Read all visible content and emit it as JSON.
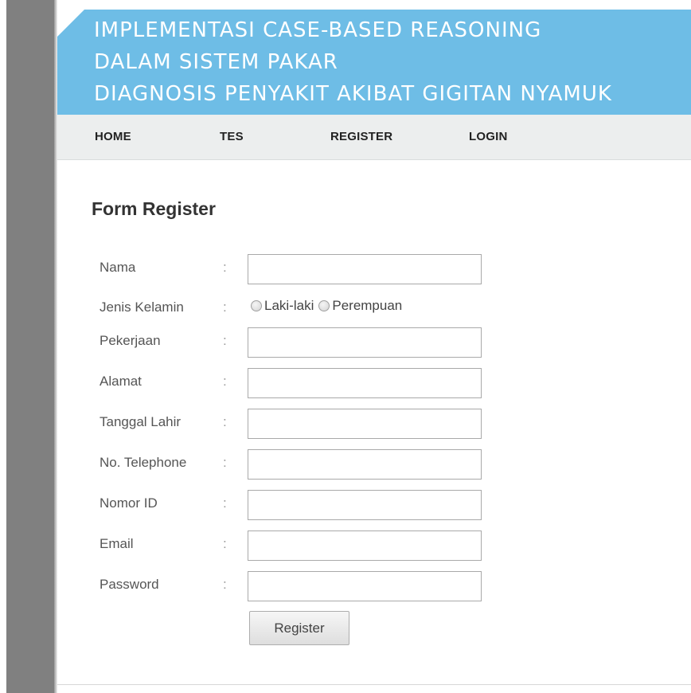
{
  "header": {
    "title_lines": [
      "IMPLEMENTASI CASE-BASED REASONING",
      "DALAM SISTEM PAKAR",
      "DIAGNOSIS PENYAKIT AKIBAT GIGITAN NYAMUK"
    ],
    "background_color": "#6ebde6"
  },
  "nav": {
    "items": [
      {
        "label": "HOME"
      },
      {
        "label": "TES"
      },
      {
        "label": "REGISTER"
      },
      {
        "label": "LOGIN"
      }
    ]
  },
  "form": {
    "title": "Form Register",
    "colon": ":",
    "fields": {
      "nama": {
        "label": "Nama",
        "value": ""
      },
      "jenis_kelamin": {
        "label": "Jenis Kelamin",
        "options": [
          "Laki-laki",
          "Perempuan"
        ]
      },
      "pekerjaan": {
        "label": "Pekerjaan",
        "value": ""
      },
      "alamat": {
        "label": "Alamat",
        "value": ""
      },
      "tanggal_lahir": {
        "label": "Tanggal Lahir",
        "value": ""
      },
      "telephone": {
        "label": "No. Telephone",
        "value": ""
      },
      "nomor_id": {
        "label": "Nomor ID",
        "value": ""
      },
      "email": {
        "label": "Email",
        "value": ""
      },
      "password": {
        "label": "Password",
        "value": ""
      }
    },
    "submit_label": "Register"
  }
}
